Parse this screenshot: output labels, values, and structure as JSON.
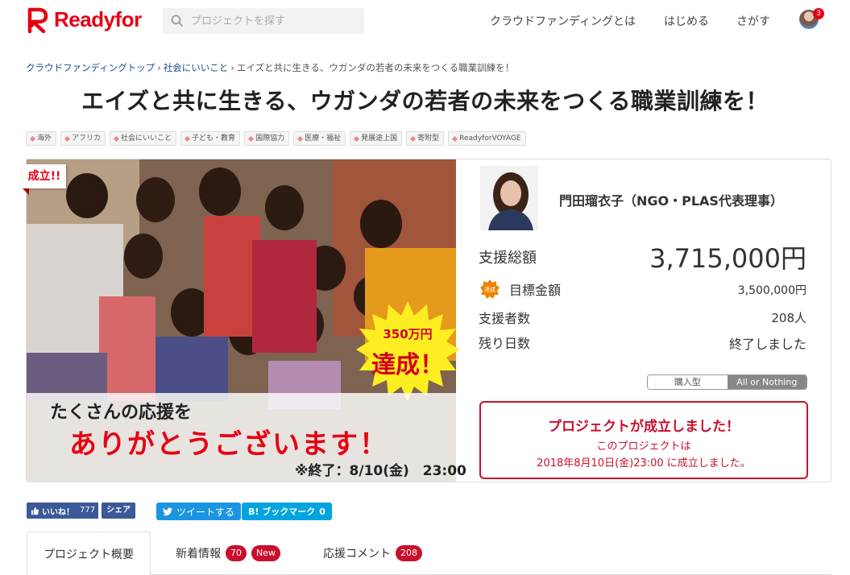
{
  "brand": {
    "name": "Readyfor",
    "color": "#e60012"
  },
  "search": {
    "placeholder": "プロジェクトを探す"
  },
  "nav": {
    "items": [
      "クラウドファンディングとは",
      "はじめる",
      "さがす"
    ],
    "notification_count": "3"
  },
  "breadcrumb": {
    "items": [
      "クラウドファンディングトップ",
      "社会にいいこと"
    ],
    "current": "エイズと共に生きる、ウガンダの若者の未来をつくる職業訓練を！",
    "separator": "›"
  },
  "project": {
    "title": "エイズと共に生きる、ウガンダの若者の未来をつくる職業訓練を！",
    "tags": [
      "海外",
      "アフリカ",
      "社会にいいこと",
      "子ども・教育",
      "国際協力",
      "医療・福祉",
      "発展途上国",
      "寄附型",
      "ReadyforVOYAGE"
    ]
  },
  "hero": {
    "success_badge": "成立!!",
    "burst_amount": "350万円",
    "burst_achieved": "達成！",
    "thanks_line1": "たくさんの応援を",
    "thanks_line2": "ありがとうございます！",
    "end_note": "※終了：8/10(金)　23:00"
  },
  "owner": {
    "name": "門田瑠衣子（NGO・PLAS代表理事）"
  },
  "stats": {
    "total_label": "支援総額",
    "total_value": "3,715,000円",
    "goal_badge": "達成",
    "goal_label": "目標金額",
    "goal_value": "3,500,000円",
    "backers_label": "支援者数",
    "backers_value": "208人",
    "days_label": "残り日数",
    "days_value": "終了しました"
  },
  "funding_type": {
    "options": [
      "購入型",
      "All or Nothing"
    ],
    "selected": "All or Nothing"
  },
  "success": {
    "title": "プロジェクトが成立しました！",
    "line2": "このプロジェクトは",
    "line3": "2018年8月10日(金)23:00 に成立しました。"
  },
  "social": {
    "fb_like": "いいね！",
    "fb_count": "777",
    "fb_share": "シェア",
    "tweet": "ツイートする",
    "hatena": "B! ブックマーク",
    "hatena_count": "0"
  },
  "tabs": [
    {
      "label": "プロジェクト概要"
    },
    {
      "label": "新着情報",
      "count": "70",
      "badge": "New"
    },
    {
      "label": "応援コメント",
      "count": "208"
    }
  ],
  "colors": {
    "accent": "#c8102e",
    "facebook": "#3b5998",
    "twitter": "#1b95e0",
    "hatena": "#00a4de"
  }
}
